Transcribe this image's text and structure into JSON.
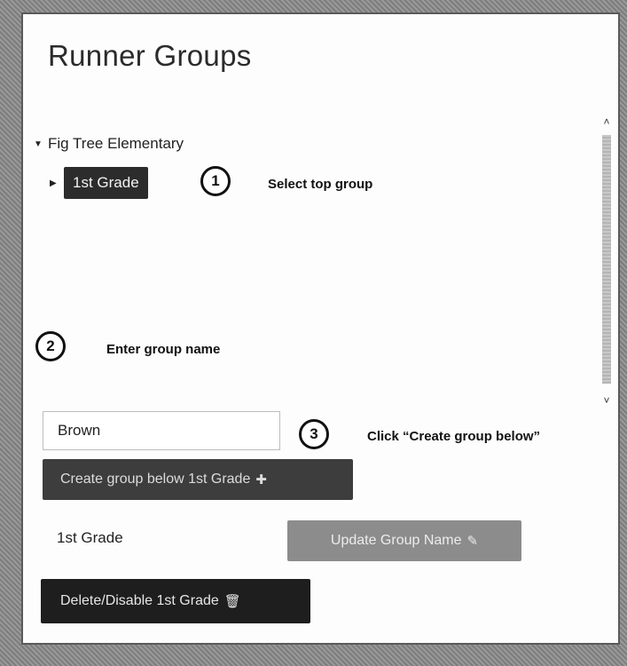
{
  "page": {
    "title": "Runner Groups"
  },
  "tree": {
    "root": {
      "label": "Fig Tree Elementary",
      "expanded": true
    },
    "child": {
      "label": "1st Grade",
      "selected": true,
      "expanded": false
    }
  },
  "steps": [
    {
      "number": "1",
      "text": "Select top group"
    },
    {
      "number": "2",
      "text": "Enter group name"
    },
    {
      "number": "3",
      "text": "Click “Create group below”"
    }
  ],
  "form": {
    "group_name_value": "Brown",
    "create_label": "Create group below 1st Grade",
    "current_group_name": "1st Grade",
    "update_label": "Update Group Name",
    "delete_label": "Delete/Disable 1st Grade"
  },
  "icons": {
    "plus": "plus-icon",
    "edit": "edit-icon",
    "trash": "trash-icon",
    "caret_down": "caret-down-icon",
    "caret_right": "caret-right-icon"
  }
}
